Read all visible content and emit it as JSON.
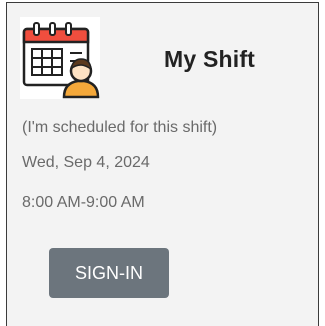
{
  "card": {
    "title": "My Shift",
    "icon": "calendar-with-person-icon",
    "note": "(I'm scheduled for this shift)",
    "date": "Wed, Sep 4, 2024",
    "time": "8:00 AM-9:00 AM",
    "signin_label": "SIGN-IN"
  },
  "colors": {
    "card_background": "#f3f3f3",
    "button_background": "#6c757d",
    "calendar_header": "#f04e3e"
  }
}
